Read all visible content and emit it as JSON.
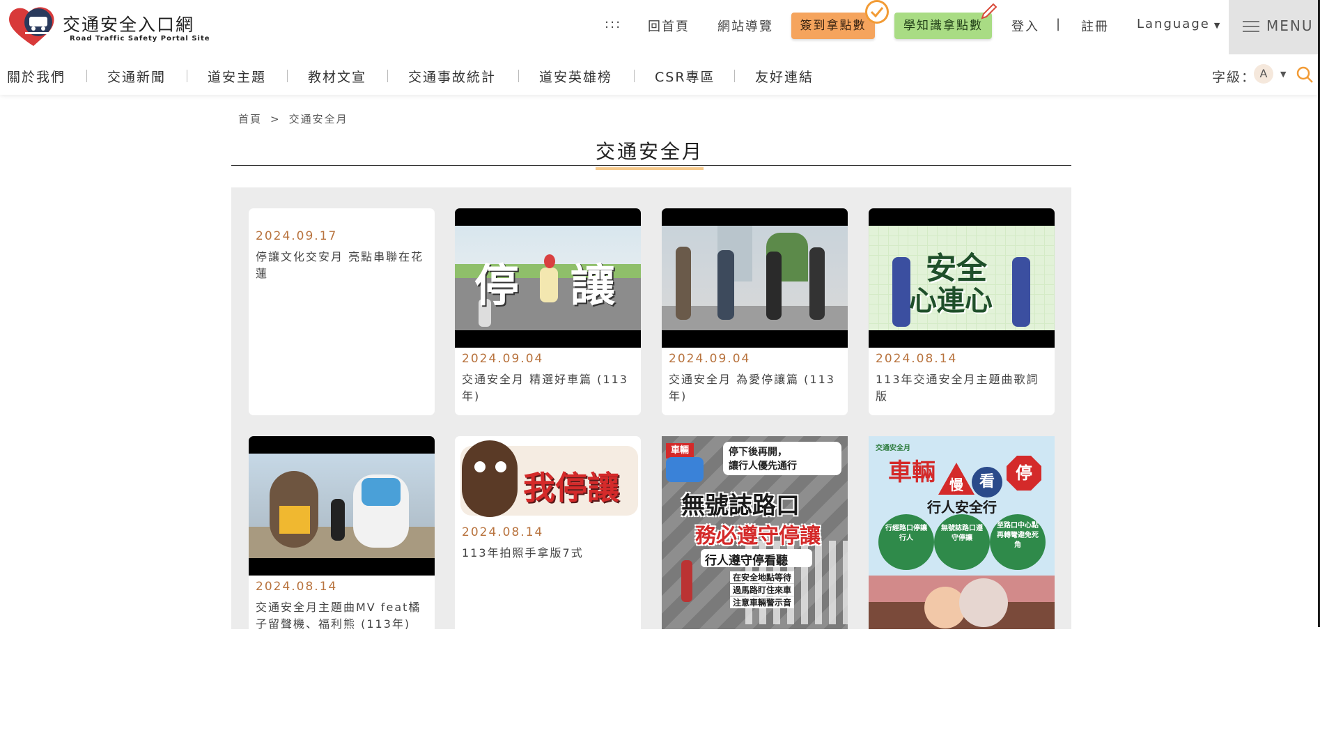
{
  "site": {
    "title": "交通安全入口網",
    "subtitle": "Road Traffic Safety Portal Site",
    "logo_mark": "道安"
  },
  "topnav": {
    "accessibility": ":::",
    "home": "回首頁",
    "sitemap": "網站導覽",
    "checkin_points": "簽到拿點數",
    "learn_points": "學知識拿點數",
    "login": "登入",
    "divider": "|",
    "register": "註冊",
    "language": "Language",
    "menu": "MENU"
  },
  "mainnav": {
    "items": [
      "關於我們",
      "交通新聞",
      "道安主題",
      "教材文宣",
      "交通事故統計",
      "道安英雄榜",
      "CSR專區",
      "友好連結"
    ],
    "fontsize_label": "字級：",
    "fontsize_value": "A"
  },
  "breadcrumb": {
    "home": "首頁",
    "separator": ">",
    "current": "交通安全月"
  },
  "page": {
    "title": "交通安全月"
  },
  "cards": [
    {
      "date": "2024.09.17",
      "text": "停讓文化交安月 亮點串聯在花蓮"
    },
    {
      "date": "2024.09.04",
      "text": "交通安全月 精選好車篇 (113年)",
      "thumb_text_1": "停",
      "thumb_text_2": "讓"
    },
    {
      "date": "2024.09.04",
      "text": "交通安全月 為愛停讓篇 (113年)"
    },
    {
      "date": "2024.08.14",
      "text": "113年交通安全月主題曲歌詞版",
      "thumb_text_1": "安全",
      "thumb_text_2": "心連心"
    },
    {
      "date": "2024.08.14",
      "text": "交通安全月主題曲MV feat橘子留聲機、福利熊 (113年)"
    },
    {
      "date": "2024.08.14",
      "text": "113年拍照手拿版7式",
      "thumb_text_1": "我停讓"
    },
    {
      "thumb_tag": "車輛",
      "thumb_line_1": "停下後再開，",
      "thumb_line_2": "讓行人優先通行",
      "thumb_big_1": "無號誌路口",
      "thumb_big_2": "務必遵守停讓",
      "thumb_sub": "行人遵守停看聽",
      "thumb_checks": [
        "在安全地點等待",
        "過馬路盯住來車",
        "注意車輛警示音"
      ]
    },
    {
      "thumb_small": "交通安全月",
      "thumb_big_1": "車輛",
      "thumb_big_2": "慢",
      "thumb_big_3": "看",
      "thumb_big_4": "停",
      "thumb_sub": "行人安全行",
      "thumb_circles": [
        "行經路口停讓行人",
        "無號誌路口遵守停讓",
        "至路口中心點再轉彎避免死角"
      ]
    }
  ],
  "colors": {
    "accent_orange": "#f5a45d",
    "accent_green": "#a9dc84",
    "date_color": "#b8733e",
    "title_underline": "#f6c98b"
  }
}
